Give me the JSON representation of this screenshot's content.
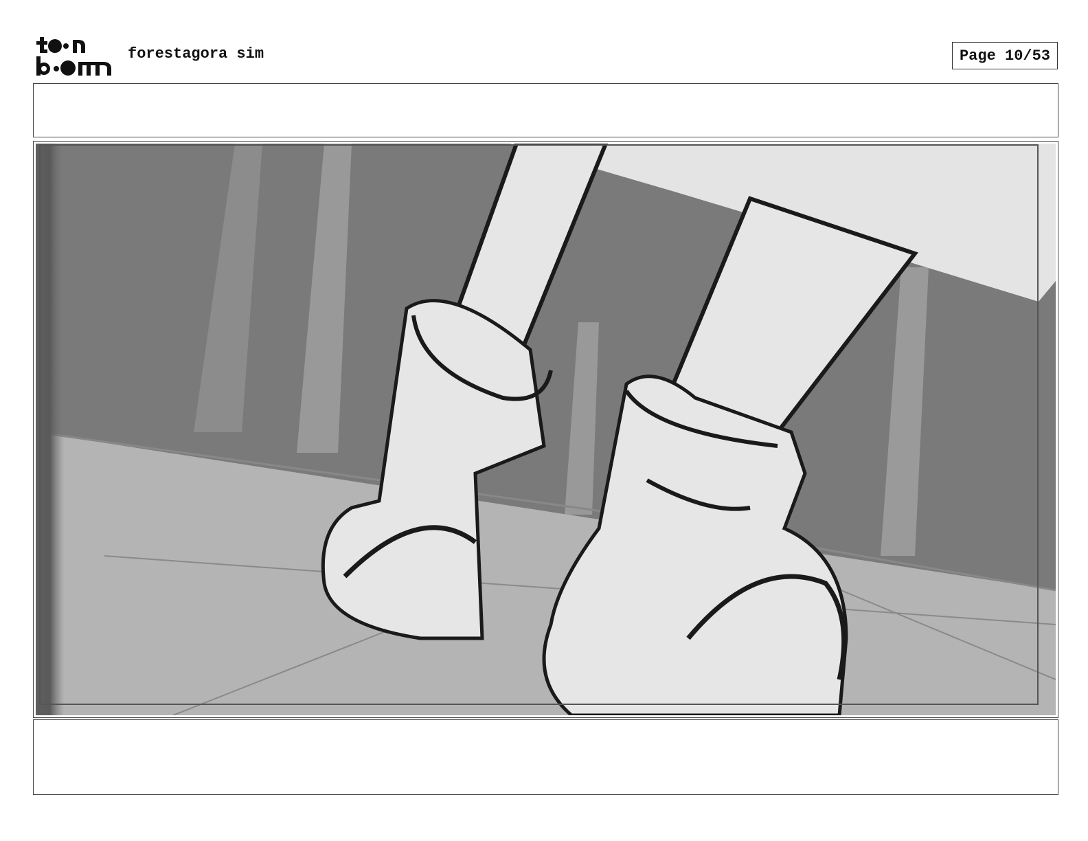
{
  "header": {
    "logo_text": "toon boom",
    "project_title": "forestagora sim",
    "page_label": "Page 10/53"
  },
  "panel": {
    "image_icon": "storyboard-sketch-boots-icon",
    "dialogue_notes": "",
    "action_notes": ""
  },
  "colors": {
    "bg_dark": "#6e6e6e",
    "floor": "#b8b8b8",
    "boot_fill": "#e6e6e6",
    "line": "#1a1a1a"
  }
}
